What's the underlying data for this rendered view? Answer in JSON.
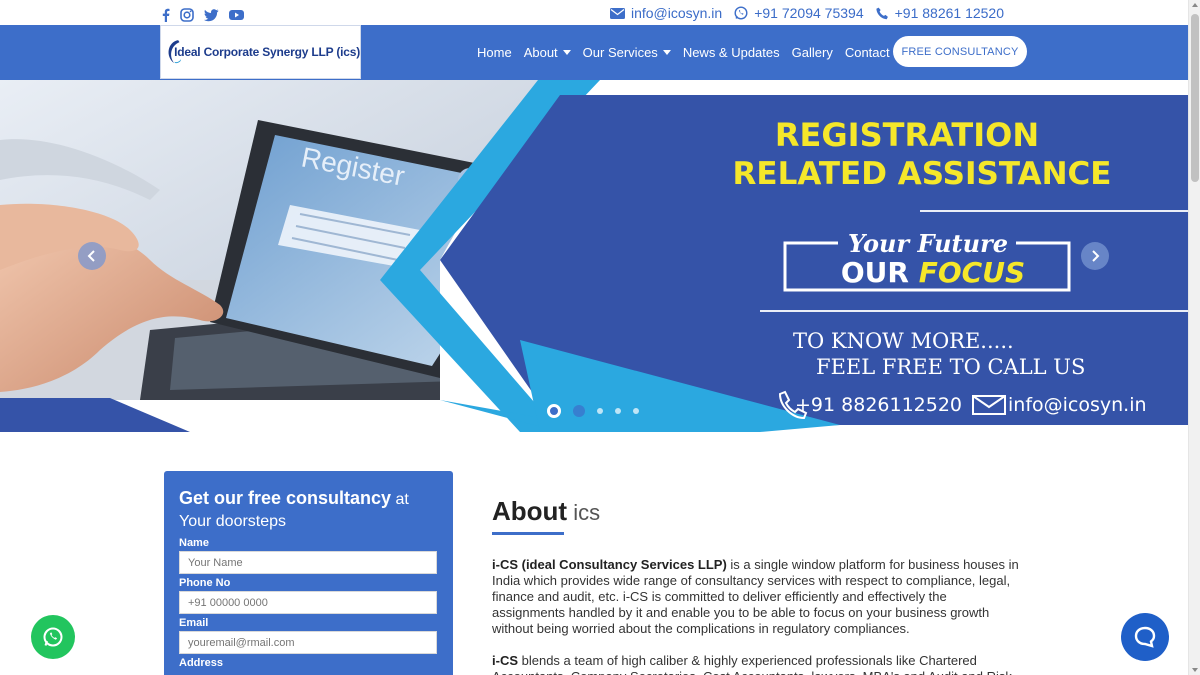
{
  "social": [
    "facebook-icon",
    "instagram-icon",
    "twitter-icon",
    "youtube-icon"
  ],
  "contact": {
    "email": "info@icosyn.in",
    "whatsapp": "+91 72094 75394",
    "phone": "+91 88261 12520"
  },
  "logo": {
    "text": "Ideal Corporate Synergy LLP (ics)"
  },
  "nav": {
    "items": [
      "Home",
      "About",
      "Our Services",
      "News & Updates",
      "Gallery",
      "Contact"
    ],
    "cta": "FREE CONSULTANCY"
  },
  "hero": {
    "screen_title": "Register",
    "headline_1": "REGISTRATION",
    "headline_2": "RELATED ASSISTANCE",
    "tag_1": "Your Future",
    "tag_2a": "OUR ",
    "tag_2b": "FOCUS",
    "cta_1": "TO KNOW MORE.....",
    "cta_2": "FEEL FREE TO CALL US",
    "phone": "+91 8826112520",
    "email": "info@icosyn.in",
    "slides": 5,
    "active_slide": 1,
    "colors": {
      "blue": "#3553a8",
      "yellow": "#f5e72a",
      "accent": "#3d6ec9"
    }
  },
  "form": {
    "title_bold": "Get our free consultancy",
    "title_light": " at",
    "subtitle": "Your doorsteps",
    "name_label": "Name",
    "name_placeholder": "Your Name",
    "phone_label": "Phone No",
    "phone_placeholder": "+91 00000 0000",
    "email_label": "Email",
    "email_placeholder": "youremail@rmail.com",
    "address_label": "Address"
  },
  "about": {
    "title_bold": "About",
    "title_light": " ics",
    "p1_bold": "i-CS (ideal Consultancy Services LLP)",
    "p1_text": " is a single window platform for business houses in India which provides wide range of consultancy services with respect to compliance, legal, finance and audit, etc. i-CS is committed to deliver efficiently and effectively the assignments handled by it and enable you to be able to focus on your business growth without being worried about the complications in regulatory compliances.",
    "p2_bold": "i-CS",
    "p2_text": " blends a team of high caliber & highly experienced professionals like Chartered Accountants, Company Secretaries, Cost Accountants, lawyers, MBA's and Audit and Risk"
  },
  "brand_colors": {
    "primary": "#3d6ec9",
    "whatsapp": "#22c55e",
    "chat": "#1f5fc8"
  }
}
